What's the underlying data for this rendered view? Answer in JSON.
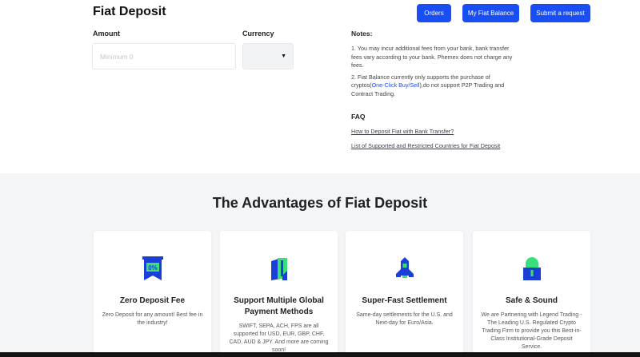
{
  "header": {
    "title": "Fiat Deposit",
    "orders_label": "Orders",
    "balance_label": "My Fiat Balance",
    "request_label": "Submit a request"
  },
  "form": {
    "amount_label": "Amount",
    "amount_placeholder": "Minimum 0",
    "currency_label": "Currency",
    "currency_value": ""
  },
  "notes": {
    "title": "Notes:",
    "note1": "1. You may incur additional fees from your bank, bank transfer fees vary according to your bank. Phemex does not charge any fees.",
    "note2_pre": "2. Fiat Balance currently only supports the purchase of cryptos(",
    "note2_link": "One-Click Buy/Sell",
    "note2_post": "),do not support P2P Trading and Contract Trading."
  },
  "faq": {
    "title": "FAQ",
    "link1": "How to Deposit Fiat with Bank Transfer?",
    "link2": "List of Supported and Restricted Countries for Fiat Deposit"
  },
  "advantages": {
    "title": "The Advantages of Fiat Deposit",
    "cards": [
      {
        "icon": "zero-percent-fee-icon",
        "title": "Zero Deposit Fee",
        "desc": "Zero Deposit for any amount! Best fee in the industry!"
      },
      {
        "icon": "payment-methods-icon",
        "title": "Support Multiple Global Payment Methods",
        "desc": "SWIFT, SEPA, ACH, FPS are all supported for USD, EUR, GBP, CHF, CAD, AUD & JPY. And more are coming soon!"
      },
      {
        "icon": "rocket-icon",
        "title": "Super-Fast Settlement",
        "desc": "Same-day settlements for the U.S. and Next-day for Euro/Asia."
      },
      {
        "icon": "lock-icon",
        "title": "Safe & Sound",
        "desc": "We are Partnering with Legend Trading - The Leading U.S. Regulated Crypto Trading Firm to provide you this Best-in-Class Institutional-Grade Deposit Service."
      }
    ]
  },
  "colors": {
    "accent": "#1a4ef5",
    "icon_blue": "#1b3fd6",
    "icon_green": "#39e07a"
  }
}
